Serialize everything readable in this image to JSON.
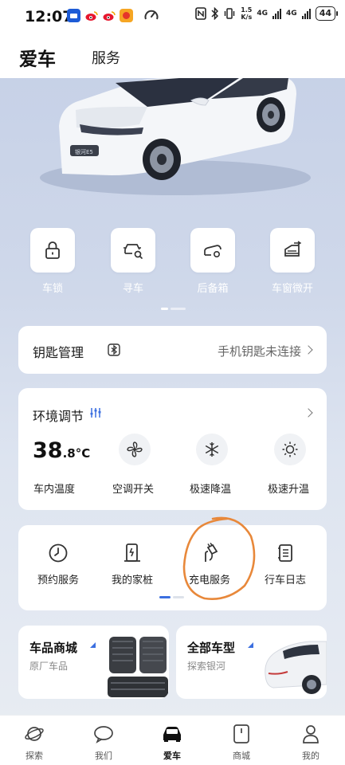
{
  "status_bar": {
    "time": "12:07",
    "speed_top": "1.5",
    "speed_bottom": "K/s",
    "net1": "4G",
    "net2": "4G",
    "battery": "44"
  },
  "header": {
    "active_tab": "爱车",
    "tab_service": "服务"
  },
  "quick_controls": [
    {
      "label": "车锁",
      "icon": "lock-icon"
    },
    {
      "label": "寻车",
      "icon": "find-car-icon"
    },
    {
      "label": "后备箱",
      "icon": "trunk-icon"
    },
    {
      "label": "车窗微开",
      "icon": "window-icon"
    }
  ],
  "key_card": {
    "title": "钥匙管理",
    "status": "手机钥匙未连接"
  },
  "environment": {
    "title": "环境调节",
    "temp_int": "38",
    "temp_dec": ".8",
    "temp_unit": "°C",
    "temp_label": "车内温度",
    "controls": [
      {
        "label": "空调开关",
        "icon": "fan-icon"
      },
      {
        "label": "极速降温",
        "icon": "snowflake-icon"
      },
      {
        "label": "极速升温",
        "icon": "sun-icon"
      }
    ]
  },
  "services": [
    {
      "label": "预约服务",
      "icon": "clock-icon"
    },
    {
      "label": "我的家桩",
      "icon": "charger-pile-icon"
    },
    {
      "label": "充电服务",
      "icon": "charging-plug-icon"
    },
    {
      "label": "行车日志",
      "icon": "log-icon"
    }
  ],
  "promos": [
    {
      "title": "车品商城",
      "subtitle": "原厂车品"
    },
    {
      "title": "全部车型",
      "subtitle": "探索银河"
    }
  ],
  "bottom_nav": [
    {
      "label": "探索",
      "icon": "planet-icon"
    },
    {
      "label": "我们",
      "icon": "chat-icon"
    },
    {
      "label": "爱车",
      "icon": "car-icon"
    },
    {
      "label": "商城",
      "icon": "shop-icon"
    },
    {
      "label": "我的",
      "icon": "profile-icon"
    }
  ],
  "colors": {
    "accent_blue": "#3b6fe0",
    "annotation_orange": "#e8883a",
    "card_bg": "#ffffff"
  }
}
